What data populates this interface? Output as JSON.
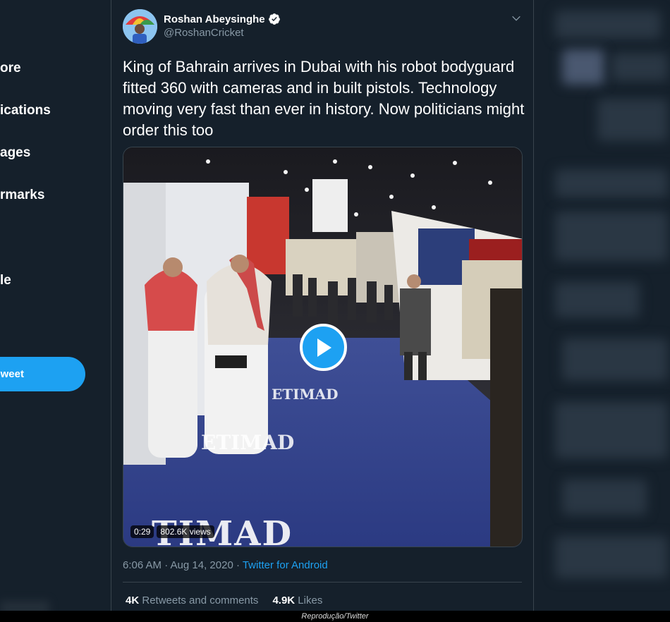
{
  "nav": {
    "items": [
      "ore",
      "ications",
      "ages",
      "rmarks",
      "le"
    ],
    "tweet_label": "weet"
  },
  "tweet": {
    "author_name": "Roshan Abeysinghe",
    "author_handle": "@RoshanCricket",
    "text": "King of Bahrain arrives in Dubai with his robot bodyguard fitted 360 with cameras and in built pistols. Technology moving very fast than ever in history. Now politicians might order this too",
    "video": {
      "duration": "0:29",
      "views": "802.6K views",
      "floor_text": "TIMAD"
    },
    "timestamp": "6:06 AM · Aug 14, 2020 · ",
    "source": "Twitter for Android",
    "retweets_count": "4K",
    "retweets_label": "Retweets and comments",
    "likes_count": "4.9K",
    "likes_label": "Likes"
  },
  "caption": "Reprodução/Twitter",
  "colors": {
    "background": "#15202b",
    "accent": "#1da1f2",
    "muted": "#8899a6",
    "border": "#38444d"
  }
}
